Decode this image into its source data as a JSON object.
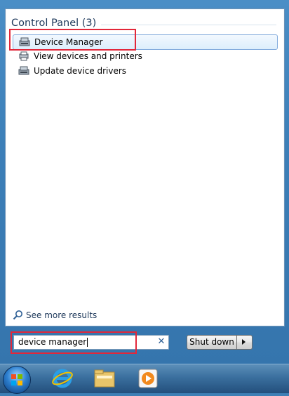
{
  "results": {
    "group_label": "Control Panel (3)",
    "items": [
      {
        "label": "Device Manager",
        "icon": "device-manager-icon"
      },
      {
        "label": "View devices and printers",
        "icon": "devices-printers-icon"
      },
      {
        "label": "Update device drivers",
        "icon": "device-manager-icon"
      }
    ],
    "see_more": "See more results"
  },
  "search": {
    "value": "device manager",
    "clear_icon": "close-icon"
  },
  "shutdown": {
    "label": "Shut down"
  },
  "taskbar": {
    "items": [
      "start-orb",
      "internet-explorer-icon",
      "windows-explorer-icon",
      "media-player-icon"
    ]
  },
  "colors": {
    "highlight": "#e2273a",
    "header_text": "#1e395b",
    "frame": "#3e7fb5"
  }
}
